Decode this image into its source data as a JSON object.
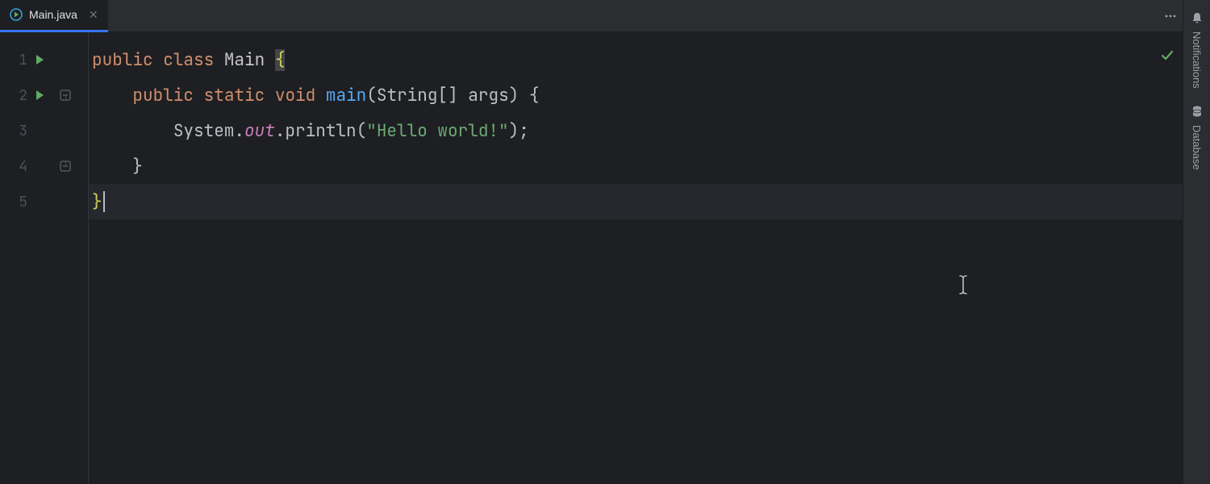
{
  "tab": {
    "filename": "Main.java"
  },
  "gutter": {
    "lines": [
      "1",
      "2",
      "3",
      "4",
      "5"
    ]
  },
  "code": {
    "l1": {
      "kw1": "public",
      "kw2": "class",
      "name": "Main",
      "brace": "{"
    },
    "l2": {
      "kw1": "public",
      "kw2": "static",
      "kw3": "void",
      "mname": "main",
      "sig": "(String[] args) {"
    },
    "l3": {
      "sys": "System.",
      "out": "out",
      "call": ".println(",
      "str": "\"Hello world!\"",
      "end": ");"
    },
    "l4": {
      "brace": "}"
    },
    "l5": {
      "brace": "}"
    }
  },
  "sidebar": {
    "notifications": "Notifications",
    "database": "Database"
  }
}
